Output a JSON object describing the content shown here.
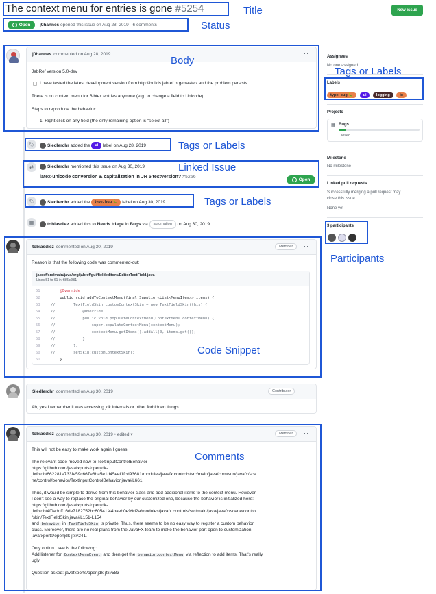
{
  "header": {
    "title": "The context menu for entries is gone",
    "number": "#5254",
    "new_issue": "New issue",
    "status": "Open",
    "meta_author": "j0hannes",
    "meta_rest": "opened this issue on Aug 28, 2019 · 6 comments"
  },
  "annotations": {
    "title": "Title",
    "status": "Status",
    "body": "Body",
    "tags1": "Tags or Labels",
    "tags2": "Tags or Labels",
    "tags3": "Tags or Labels",
    "linked": "Linked Issue",
    "participants": "Participants",
    "code": "Code Snippet",
    "comments": "Comments"
  },
  "body_comment": {
    "author": "j0hannes",
    "meta": "commented on Aug 28, 2019",
    "lines": [
      "JabRef version 5.0-dev",
      "I have tested the latest development version from http://builds.jabref.org/master/ and the problem persists",
      "There is no context menu for Bibtex entries anymore (e.g. to change a field to Unicode)",
      "Steps to reproduce the behavior:",
      "1. Right click on any field (the only remaining option is \"select all\")"
    ]
  },
  "events": {
    "e1": {
      "user": "Siedlerchr",
      "pre": "added the",
      "label": "ui",
      "post": "label on Aug 28, 2019"
    },
    "e2": {
      "user": "Siedlerchr",
      "pre": "mentioned this issue on Aug 30, 2019",
      "issue_title": "latex-unicode conversion & capitalization in JR 5 testversion?",
      "issue_num": "#5256",
      "state": "Open"
    },
    "e3": {
      "user": "Siedlerchr",
      "pre": "added the",
      "label": "type: bug 🐛",
      "post": "label on Aug 30, 2019"
    },
    "e4": {
      "user": "tobiasdiez",
      "pre": "added this to",
      "board": "Needs triage",
      "in": "in",
      "project": "Bugs",
      "via": "via",
      "via_label": "automation",
      "post": "on Aug 30, 2019"
    }
  },
  "comment2": {
    "author": "tobiasdiez",
    "meta": "commented on Aug 30, 2019",
    "badge": "Member",
    "text": "Reason is that the following code was commented-out:",
    "file": "jabref/src/main/java/org/jabref/gui/fieldeditors/EditorTextField.java",
    "lines_info": "Lines 51 to 61 in",
    "commit": "f85c081",
    "code": [
      {
        "n": "51",
        "t": "    @Override"
      },
      {
        "n": "52",
        "t": "    public void addToContextMenu(final Supplier<List<MenuItem>> items) {"
      },
      {
        "n": "53",
        "t": "//        TextFieldSkin customContextSkin = new TextFieldSkin(this) {"
      },
      {
        "n": "54",
        "t": "//            @Override"
      },
      {
        "n": "55",
        "t": "//            public void populateContextMenu(ContextMenu contextMenu) {"
      },
      {
        "n": "56",
        "t": "//                super.populateContextMenu(contextMenu);"
      },
      {
        "n": "57",
        "t": "//                contextMenu.getItems().addAll(0, items.get());"
      },
      {
        "n": "58",
        "t": "//            }"
      },
      {
        "n": "59",
        "t": "//        };"
      },
      {
        "n": "60",
        "t": "//        setSkin(customContextSkin);"
      },
      {
        "n": "61",
        "t": "    }"
      }
    ]
  },
  "comment3": {
    "author": "Siedlerchr",
    "meta": "commented on Aug 30, 2019",
    "badge": "Contributor",
    "text": "Ah, yes I remember it was accessing jdk internals or other forbidden things"
  },
  "comment4": {
    "author": "tobiasdiez",
    "meta": "commented on Aug 30, 2019 • edited ▾",
    "badge": "Member",
    "p1": "This will not be easy to make work again I guess.",
    "p2": [
      "The relevant code moved now to TextInputControlBehavior",
      "https://github.com/javafxports/openjdk-",
      "jfx/blob/662281e733fe59c667e8ba5e1d45eef1fcd93681/modules/javafx.controls/src/main/java/com/sun/javafx/sce",
      "ne/control/behavior/TextInputControlBehavior.java#L661."
    ],
    "p3": [
      "Thus, it would be simple to derive from this behavior class and add additional items to the context menu. However,",
      "I don't see a way to replace the original behavior by our customized one, because the behavior is initialized here:",
      "https://github.com/javafxports/openjdk-",
      "jfx/blob/4f0addff16de7182752bc60541f44baeb0e99d2a/modules/javafx.controls/src/main/java/javafx/scene/control",
      "/skin/TextFieldSkin.java#L151-L154"
    ],
    "p3_and": "and",
    "p3_code1": "behavior",
    "p3_in": "in",
    "p3_code2": "TextFieldSkin",
    "p3_rest": "is private. Thus, there seems to be no easy way to register a custom behavior",
    "p3_more": [
      "class. Moreover, there are no real plans from the JavaFX team to make the behavior part open to customization:",
      "javafxports/openjdk-jfx#241."
    ],
    "p4": "Only option I see is the following:",
    "p5_a": "Add listener for",
    "p5_code1": "ContextMenuEvent",
    "p5_b": "and then get the",
    "p5_code2": "behavior.contextMenu",
    "p5_c": "via reflection to add items. That's really",
    "p5_d": "ugly.",
    "p6": "Question asked: javafxports/openjdk-jfx#583"
  },
  "sidebar": {
    "assignees_title": "Assignees",
    "assignees_value": "No one assigned",
    "labels_title": "Labels",
    "labels": [
      {
        "name": "type: bug 🐛",
        "color": "#e99695"
      },
      {
        "name": "ui",
        "color": "#5319e7"
      },
      {
        "name": "logging",
        "color": "#4a2a2a"
      },
      {
        "name": "io",
        "color": "#e8804a"
      }
    ],
    "projects_title": "Projects",
    "project_name": "Bugs",
    "project_state": "Closed",
    "milestone_title": "Milestone",
    "milestone_value": "No milestone",
    "linked_title": "Linked pull requests",
    "linked_text1": "Successfully merging a pull request may",
    "linked_text2": "close this issue.",
    "linked_none": "None yet",
    "participants_title": "3 participants"
  }
}
